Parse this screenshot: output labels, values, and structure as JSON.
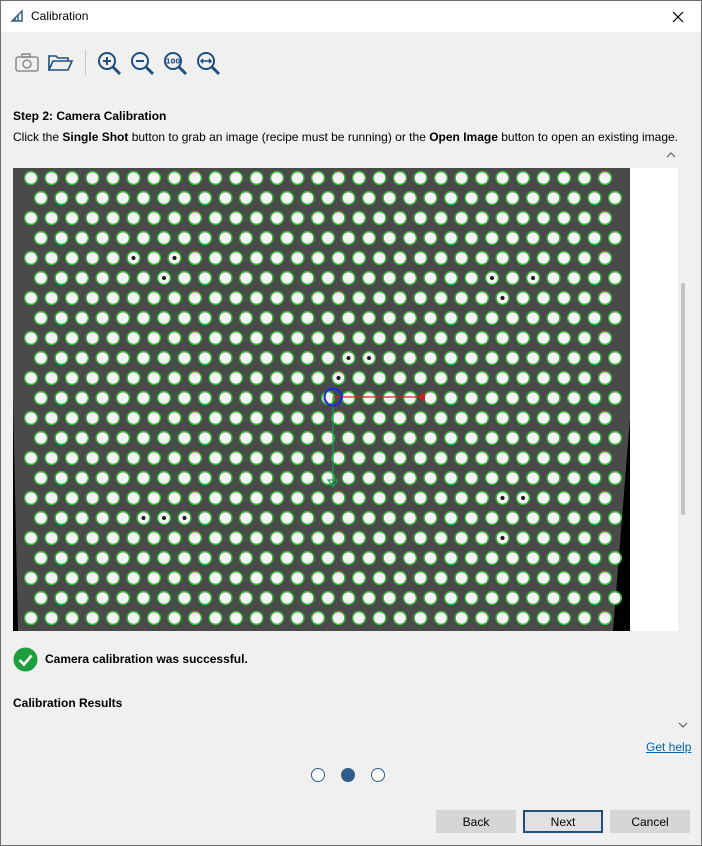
{
  "window": {
    "title": "Calibration"
  },
  "toolbar": {
    "buttons": [
      {
        "name": "single-shot",
        "icon": "camera-icon"
      },
      {
        "name": "open-image",
        "icon": "folder-open-icon"
      },
      {
        "name": "zoom-in",
        "icon": "zoom-in-icon"
      },
      {
        "name": "zoom-out",
        "icon": "zoom-out-icon"
      },
      {
        "name": "zoom-100",
        "icon": "zoom-100-icon",
        "label": "100"
      },
      {
        "name": "zoom-fit",
        "icon": "zoom-fit-icon"
      }
    ]
  },
  "step": {
    "title": "Step 2: Camera Calibration",
    "desc_part1": "Click the ",
    "desc_bold1": "Single Shot",
    "desc_part2": " button to grab an image (recipe must be running) or the ",
    "desc_bold2": "Open Image",
    "desc_part3": " button to open an existing image."
  },
  "status": {
    "message": "Camera calibration was successful.",
    "color": "#1e9e3e"
  },
  "results": {
    "title": "Calibration Results"
  },
  "help": {
    "label": "Get help"
  },
  "pager": {
    "total": 3,
    "current": 2
  },
  "buttons": {
    "back": "Back",
    "next": "Next",
    "cancel": "Cancel"
  },
  "colors": {
    "accent": "#2e5f8a",
    "link": "#0063b1",
    "detection": "#1fd41f"
  }
}
